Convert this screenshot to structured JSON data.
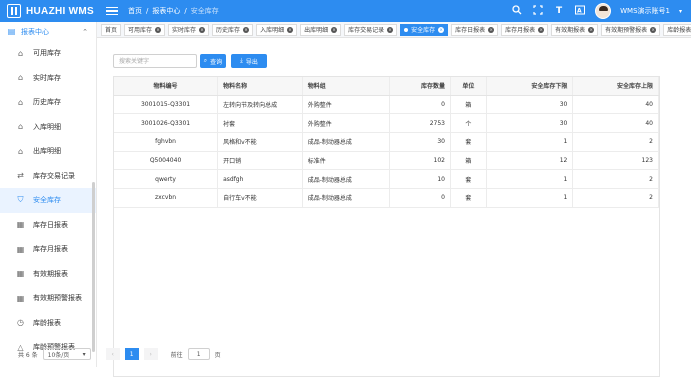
{
  "app": {
    "title": "HUAZHI WMS",
    "breadcrumb": [
      "首页",
      "报表中心",
      "安全库存"
    ],
    "user": "WMS演示账号1"
  },
  "colors": {
    "primary": "#2d8cf0",
    "active_bg": "#eaf3ff"
  },
  "sidebar": {
    "group": "报表中心",
    "items": [
      {
        "label": "可用库存",
        "icon": "home-icon"
      },
      {
        "label": "实时库存",
        "icon": "home-icon"
      },
      {
        "label": "历史库存",
        "icon": "home-icon"
      },
      {
        "label": "入库明细",
        "icon": "warehouse-in-icon"
      },
      {
        "label": "出库明细",
        "icon": "warehouse-out-icon"
      },
      {
        "label": "库存交易记录",
        "icon": "transfer-icon"
      },
      {
        "label": "安全库存",
        "icon": "shield-icon"
      },
      {
        "label": "库存日报表",
        "icon": "calendar-icon"
      },
      {
        "label": "库存月报表",
        "icon": "calendar-icon"
      },
      {
        "label": "有效期报表",
        "icon": "calendar-icon"
      },
      {
        "label": "有效期预警报表",
        "icon": "calendar-icon"
      },
      {
        "label": "库龄报表",
        "icon": "clock-icon"
      },
      {
        "label": "库龄预警报表",
        "icon": "warning-icon"
      }
    ]
  },
  "tabs": [
    "首页",
    "可用库存",
    "实时库存",
    "历史库存",
    "入库明细",
    "出库明细",
    "库存交易记录",
    "安全库存",
    "库存日报表",
    "库存月报表",
    "有效期报表",
    "有效期预警报表",
    "库龄报表",
    "库龄"
  ],
  "toolbar": {
    "search_placeholder": "搜索关键字",
    "search_label": "查询",
    "export_label": "导出"
  },
  "table": {
    "headers": [
      "物料编号",
      "物料名称",
      "物料组",
      "库存数量",
      "单位",
      "安全库存下限",
      "安全库存上限"
    ],
    "rows": [
      [
        "3001015-Q3301",
        "左转向节及转向总成",
        "外购整件",
        "0",
        "箱",
        "30",
        "40"
      ],
      [
        "3001026-Q3301",
        "衬套",
        "外购整件",
        "2753",
        "个",
        "30",
        "40"
      ],
      [
        "fghvbn",
        "风格和v不能",
        "成品-制动器总成",
        "30",
        "套",
        "1",
        "2"
      ],
      [
        "Q5004040",
        "开口销",
        "标准件",
        "102",
        "箱",
        "12",
        "123"
      ],
      [
        "qwerty",
        "asdfgh",
        "成品-制动器总成",
        "10",
        "套",
        "1",
        "2"
      ],
      [
        "zxcvbn",
        "自行车v不能",
        "成品-制动器总成",
        "0",
        "套",
        "1",
        "2"
      ]
    ]
  },
  "pager": {
    "total": "共 6 条",
    "page_size": "10条/页",
    "current": "1",
    "goto": "前往",
    "goto_value": "1",
    "page_suffix": "页"
  }
}
